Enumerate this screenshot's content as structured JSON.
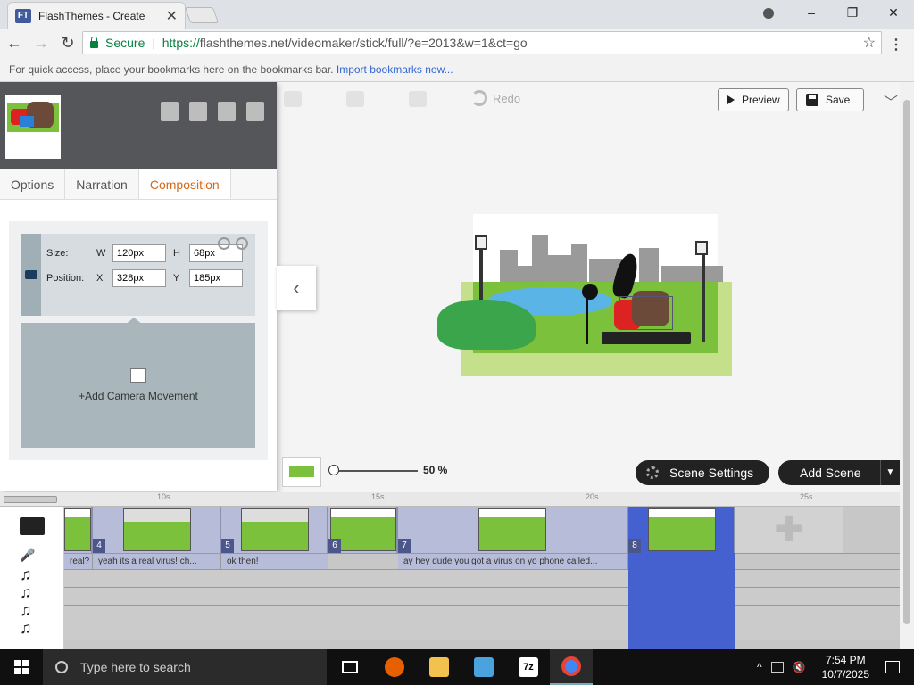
{
  "browser": {
    "tab_title": "FlashThemes - Create",
    "favicon_text": "FT",
    "secure_label": "Secure",
    "url_scheme": "https://",
    "url_rest": "flashthemes.net/videomaker/stick/full/?e=2013&w=1&ct=go",
    "bookmarks_text": "For quick access, place your bookmarks here on the bookmarks bar.",
    "bookmarks_link": "Import bookmarks now...",
    "window_controls": [
      "–",
      "❐",
      "✕"
    ]
  },
  "toolbar": {
    "redo_label": "Redo",
    "preview_label": "Preview",
    "save_label": "Save"
  },
  "panel": {
    "tabs": [
      {
        "label": "Options"
      },
      {
        "label": "Narration"
      },
      {
        "label": "Composition",
        "active": true
      }
    ],
    "size_label": "Size:",
    "position_label": "Position:",
    "w_label": "W",
    "h_label": "H",
    "x_label": "X",
    "y_label": "Y",
    "w_value": "120px",
    "h_value": "68px",
    "x_value": "328px",
    "y_value": "185px",
    "add_camera_label": "+Add Camera Movement"
  },
  "stage_tools": {
    "zoom_value": "50 %",
    "zoom_fraction": 0.5,
    "scene_settings_label": "Scene Settings",
    "add_scene_label": "Add Scene"
  },
  "timeline": {
    "ruler_marks": [
      "10s",
      "15s",
      "20s",
      "25s"
    ],
    "scenes": [
      {
        "num": "",
        "thumb": "dark"
      },
      {
        "num": "4",
        "thumb": "park"
      },
      {
        "num": "5",
        "thumb": "park"
      },
      {
        "num": "6",
        "thumb": "dark"
      },
      {
        "num": "7",
        "thumb": "dark"
      },
      {
        "num": "8",
        "thumb": "dark",
        "selected": true
      }
    ],
    "narrations": [
      "real?",
      "yeah its a real virus! ch...",
      "ok then!",
      "ay hey dude you got a virus on yo phone called..."
    ]
  },
  "taskbar": {
    "search_placeholder": "Type here to search",
    "time": "7:54 PM",
    "date": "10/7/2025",
    "apps": [
      "task-view",
      "firefox",
      "file-explorer",
      "app-4",
      "7zip",
      "chrome"
    ]
  },
  "colors": {
    "accent": "#d2691e",
    "secure": "#0b8043",
    "selected_scene": "#4560cf"
  }
}
